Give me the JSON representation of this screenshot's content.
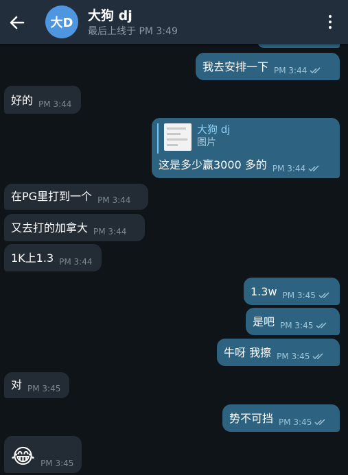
{
  "header": {
    "avatar_text": "大D",
    "title": "大狗 dj",
    "status": "最后上线于 PM 3:49"
  },
  "messages": [
    {
      "dir": "out",
      "text": "我去安排一下",
      "time": "PM 3:44"
    },
    {
      "dir": "in",
      "text": "好的",
      "time": "PM 3:44"
    },
    {
      "dir": "out",
      "text": "这是多少赢3000 多的",
      "time": "PM 3:44",
      "reply": {
        "name": "大狗 dj",
        "label": "图片"
      }
    },
    {
      "dir": "in",
      "text": "在PG里打到一个",
      "time": "PM 3:44"
    },
    {
      "dir": "in",
      "text": "又去打的加拿大",
      "time": "PM 3:44"
    },
    {
      "dir": "in",
      "text": "1K上1.3",
      "time": "PM 3:44"
    },
    {
      "dir": "out",
      "text": "1.3w",
      "time": "PM 3:45"
    },
    {
      "dir": "out",
      "text": "是吧",
      "time": "PM 3:45"
    },
    {
      "dir": "out",
      "text": "牛呀 我擦",
      "time": "PM 3:45"
    },
    {
      "dir": "in",
      "text": "对",
      "time": "PM 3:45"
    },
    {
      "dir": "out",
      "text": "势不可挡",
      "time": "PM 3:45"
    },
    {
      "dir": "in",
      "text": "😂",
      "time": "PM 3:45",
      "emoji": true
    }
  ],
  "colors": {
    "background": "#0f1419",
    "header": "#232e3c",
    "incoming_bubble": "#232c35",
    "outgoing_bubble": "#2d6380",
    "avatar": "#4e96e0"
  },
  "icons": {
    "back": "arrow-left-icon",
    "menu": "more-vertical-icon",
    "read": "double-check-icon"
  }
}
